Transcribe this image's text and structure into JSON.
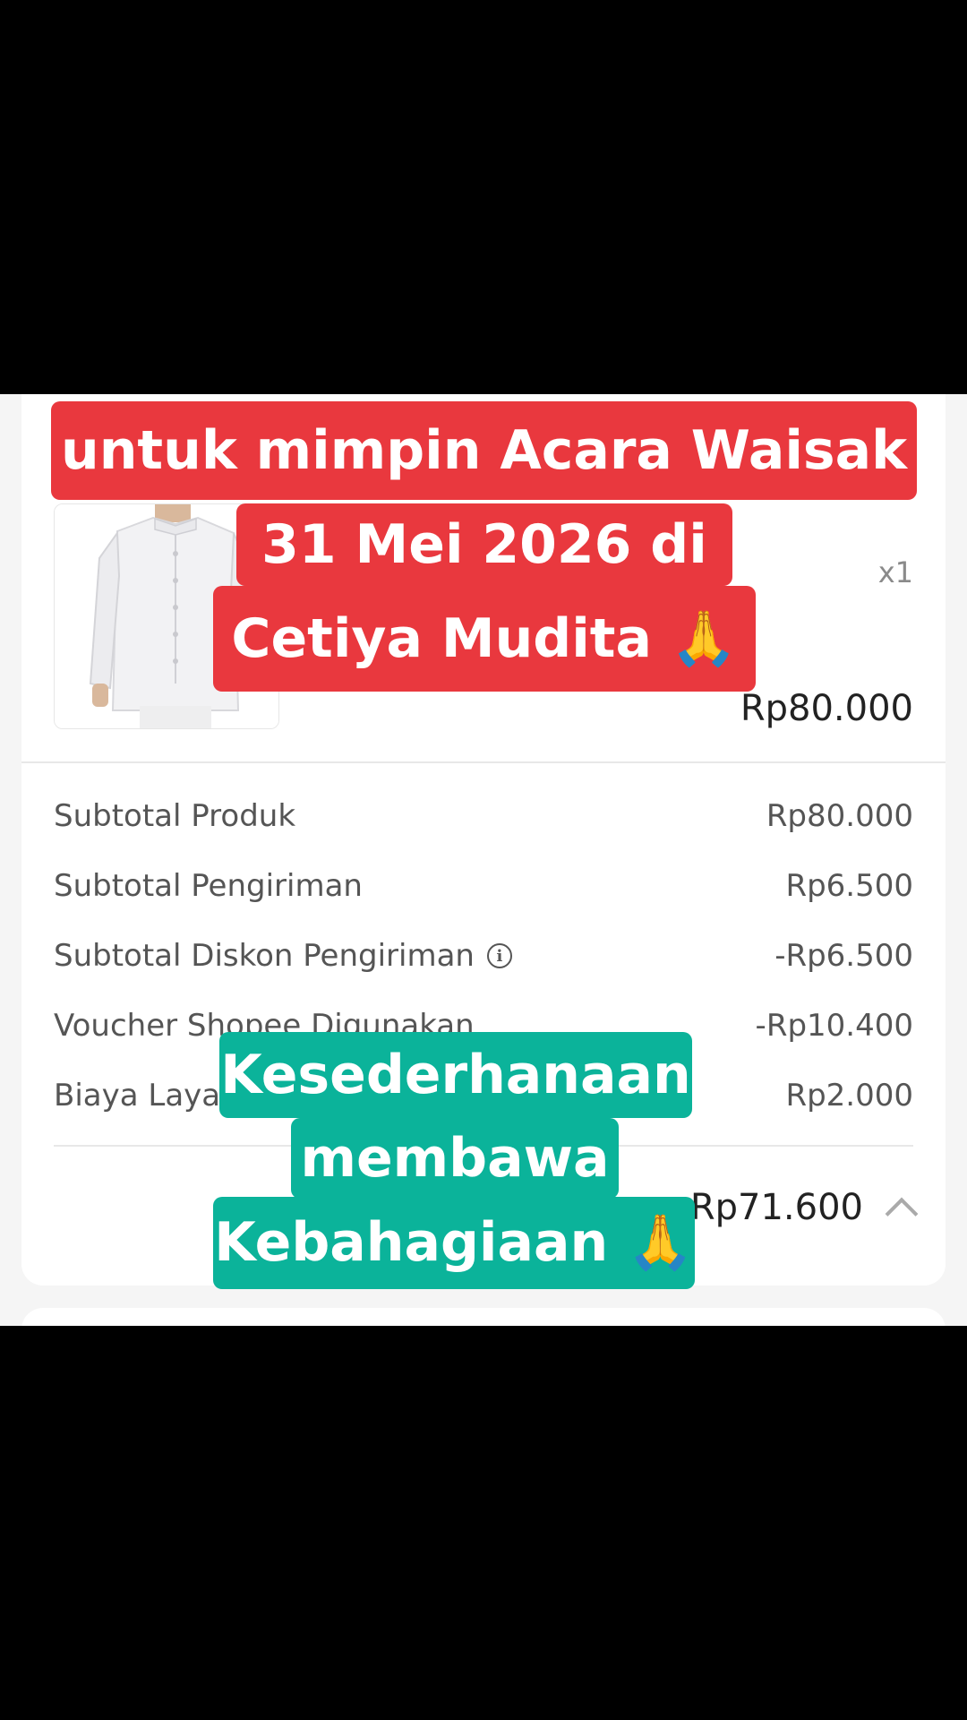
{
  "product": {
    "quantity": "x1",
    "price": "Rp80.000",
    "image_icon": "white-suit-product-photo"
  },
  "summary": {
    "rows": [
      {
        "label": "Subtotal Produk",
        "value": "Rp80.000"
      },
      {
        "label": "Subtotal Pengiriman",
        "value": "Rp6.500"
      },
      {
        "label": "Subtotal Diskon Pengiriman",
        "value": "-Rp6.500"
      },
      {
        "label": "Voucher Shopee Digunakan",
        "value": "-Rp10.400"
      },
      {
        "label": "Biaya Layanan",
        "value": "Rp2.000"
      }
    ],
    "total": "Rp71.600",
    "info_icon": "info-icon",
    "collapse_icon": "chevron-up-icon"
  },
  "captions": {
    "top": [
      "untuk mimpin  Acara Waisak",
      "31 Mei 2026 di",
      "Cetiya Mudita 🙏"
    ],
    "bottom": [
      "Kesederhanaan",
      "membawa",
      "Kebahagiaan 🙏"
    ],
    "colors": {
      "red": "#e9383e",
      "teal": "#0bb39a"
    }
  }
}
